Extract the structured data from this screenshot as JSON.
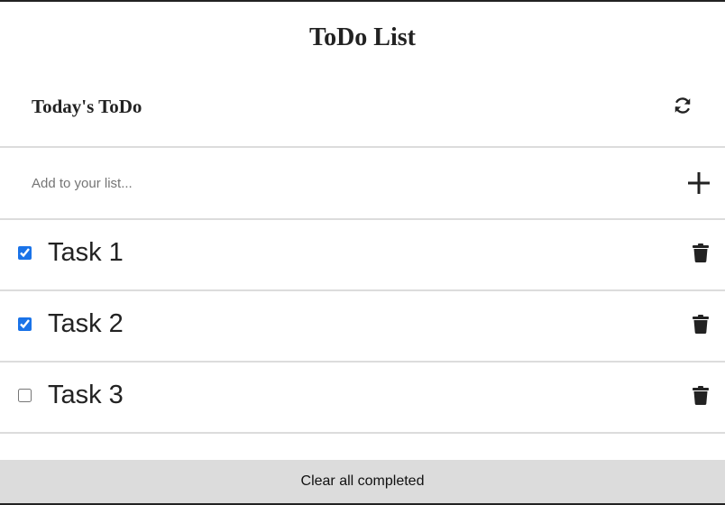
{
  "app": {
    "title": "ToDo List"
  },
  "list": {
    "title": "Today's ToDo",
    "refresh_icon": "refresh-icon"
  },
  "add": {
    "placeholder": "Add to your list...",
    "value": "",
    "add_icon": "plus-icon"
  },
  "tasks": [
    {
      "label": "Task 1",
      "completed": true,
      "delete_icon": "trash-icon"
    },
    {
      "label": "Task 2",
      "completed": true,
      "delete_icon": "trash-icon"
    },
    {
      "label": "Task 3",
      "completed": false,
      "delete_icon": "trash-icon"
    }
  ],
  "footer": {
    "clear_label": "Clear all completed"
  },
  "colors": {
    "accent": "#1a73e8",
    "divider": "#dcdcdc",
    "footer_bg": "#dcdcdc",
    "text": "#222222"
  }
}
